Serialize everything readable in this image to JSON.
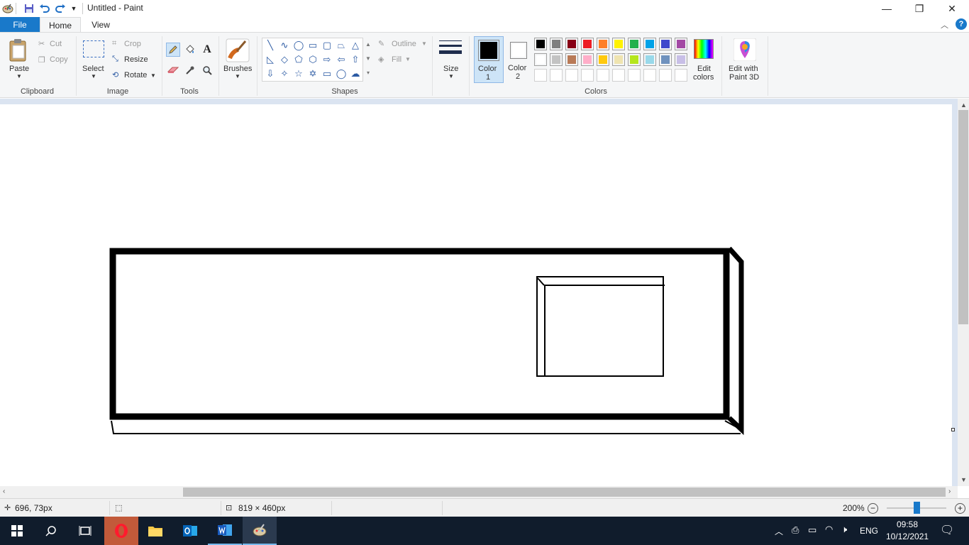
{
  "window": {
    "title": "Untitled - Paint",
    "minimize": "—",
    "restore": "❐",
    "close": "✕"
  },
  "quick_access": {
    "save_icon": "save-icon",
    "undo_icon": "undo-icon",
    "redo_icon": "redo-icon",
    "customize_icon": "chevron-down-icon"
  },
  "tabs": {
    "file": "File",
    "home": "Home",
    "view": "View"
  },
  "ribbon": {
    "clipboard": {
      "paste": "Paste",
      "cut": "Cut",
      "copy": "Copy",
      "group": "Clipboard"
    },
    "image": {
      "select": "Select",
      "crop": "Crop",
      "resize": "Resize",
      "rotate": "Rotate",
      "group": "Image"
    },
    "tools": {
      "group": "Tools",
      "text_glyph": "A"
    },
    "brushes": {
      "label": "Brushes"
    },
    "shapes": {
      "outline": "Outline",
      "fill": "Fill",
      "group": "Shapes"
    },
    "size": {
      "label": "Size"
    },
    "colors": {
      "color1_line1": "Color",
      "color1_line2": "1",
      "color2_line1": "Color",
      "color2_line2": "2",
      "edit_line1": "Edit",
      "edit_line2": "colors",
      "group": "Colors",
      "color1_value": "#000000",
      "color2_value": "#ffffff",
      "palette_row1": [
        "#000000",
        "#7f7f7f",
        "#880015",
        "#ed1c24",
        "#ff7f27",
        "#fff200",
        "#22b14c",
        "#00a2e8",
        "#3f48cc",
        "#a349a4"
      ],
      "palette_row2": [
        "#ffffff",
        "#c3c3c3",
        "#b97a57",
        "#ffaec9",
        "#ffc90e",
        "#efe4b0",
        "#b5e61d",
        "#99d9ea",
        "#7092be",
        "#c8bfe7"
      ]
    },
    "paint3d": {
      "line1": "Edit with",
      "line2": "Paint 3D"
    }
  },
  "status": {
    "cursor_pos": "696, 73px",
    "image_size": "819 × 460px",
    "zoom": "200%",
    "zoom_fraction": 0.5
  },
  "taskbar": {
    "time": "09:58",
    "date": "10/12/2021",
    "language": "ENG"
  }
}
